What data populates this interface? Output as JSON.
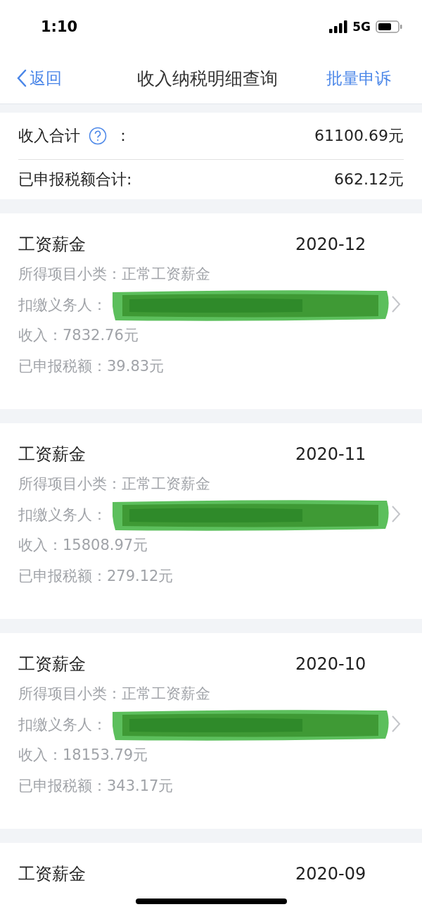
{
  "status_bar": {
    "time": "1:10",
    "network": "5G"
  },
  "nav": {
    "back": "返回",
    "title": "收入纳税明细查询",
    "action": "批量申诉"
  },
  "summary": {
    "income_label": "收入合计",
    "income_colon": "：",
    "income_value": "61100.69元",
    "tax_label": "已申报税额合计:",
    "tax_value": "662.12元"
  },
  "records": [
    {
      "category": "工资薪金",
      "period": "2020-12",
      "subcategory": "所得项目小类：正常工资薪金",
      "payer_label": "扣缴义务人：",
      "income": "收入：7832.76元",
      "tax": "已申报税额：39.83元",
      "redacted": true
    },
    {
      "category": "工资薪金",
      "period": "2020-11",
      "subcategory": "所得项目小类：正常工资薪金",
      "payer_label": "扣缴义务人：",
      "income": "收入：15808.97元",
      "tax": "已申报税额：279.12元",
      "redacted": true
    },
    {
      "category": "工资薪金",
      "period": "2020-10",
      "subcategory": "所得项目小类：正常工资薪金",
      "payer_label": "扣缴义务人：",
      "income": "收入：18153.79元",
      "tax": "已申报税额：343.17元",
      "redacted": true
    },
    {
      "category": "工资薪金",
      "period": "2020-09"
    }
  ]
}
